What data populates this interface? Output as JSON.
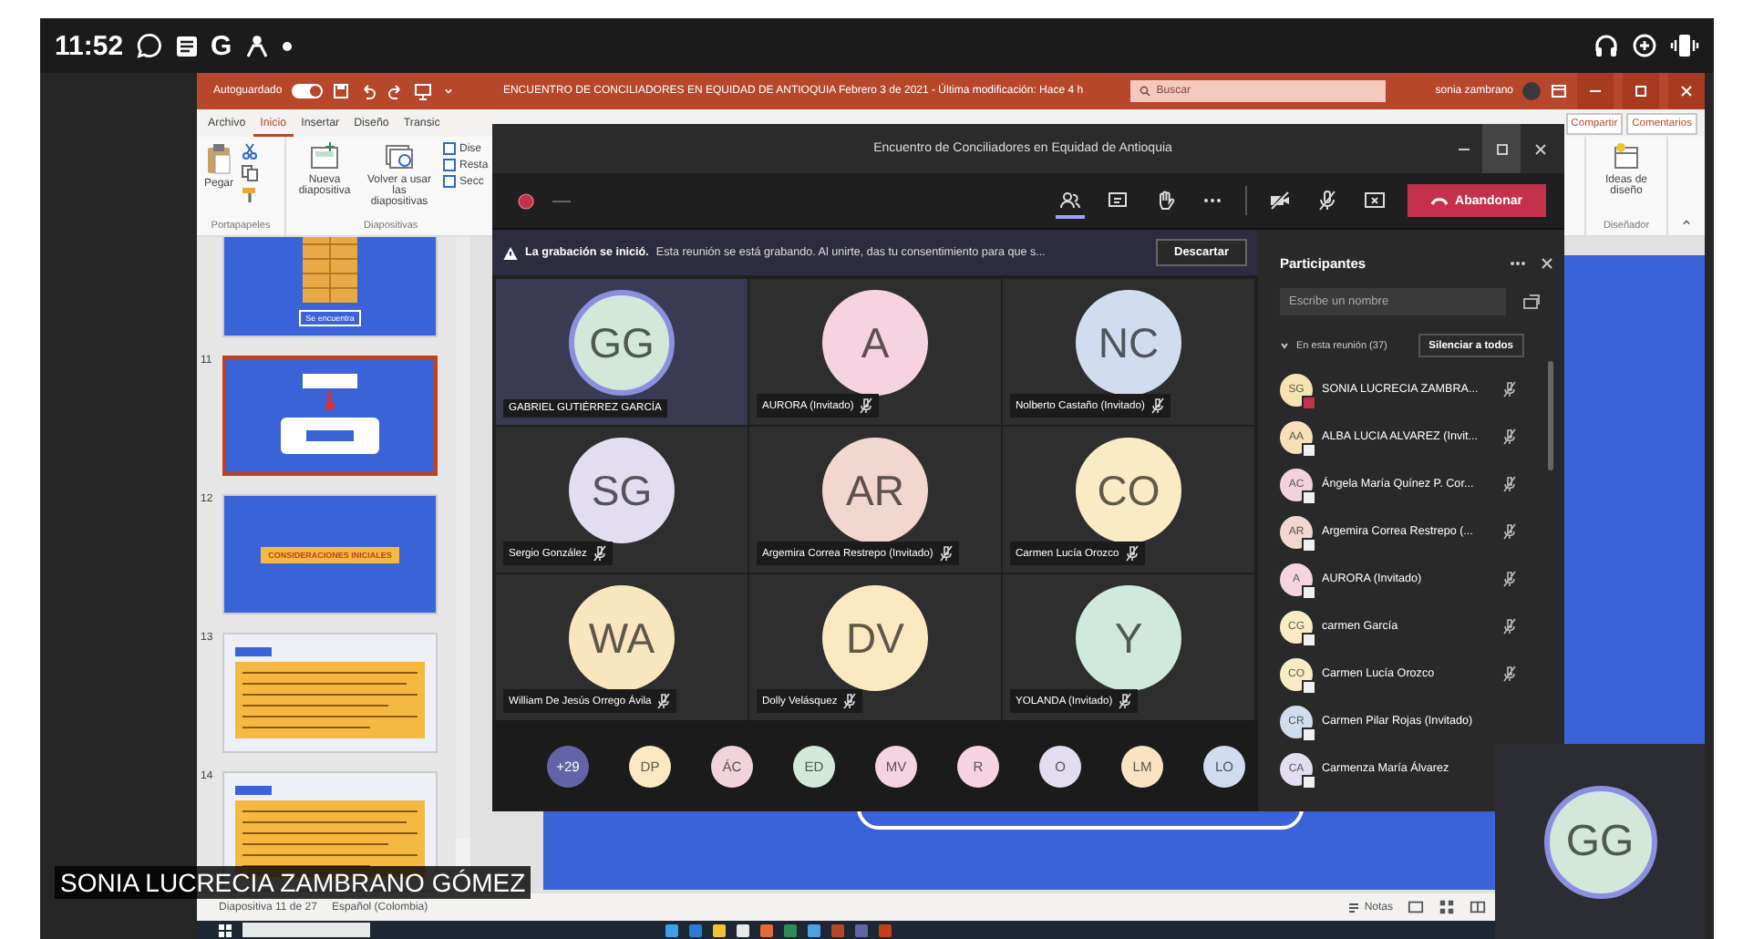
{
  "status_bar": {
    "time": "11:52",
    "app_letter": "G"
  },
  "powerpoint": {
    "autosave_label": "Autoguardado",
    "autosave_on": true,
    "title": "ENCUENTRO DE CONCILIADORES EN EQUIDAD DE ANTIOQUIA Febrero 3 de 2021 - Última modificación: Hace 4 h",
    "search_placeholder": "Buscar",
    "user": "sonia zambrano",
    "tabs": [
      {
        "label": "Archivo",
        "selected": false
      },
      {
        "label": "Inicio",
        "selected": true
      },
      {
        "label": "Insertar",
        "selected": false
      },
      {
        "label": "Diseño",
        "selected": false
      },
      {
        "label": "Transic",
        "selected": false
      }
    ],
    "share": "Compartir",
    "comments": "Comentarios",
    "ribbon": {
      "paste": "Pegar",
      "new_slide": "Nueva diapositiva",
      "reuse": "Volver a usar las diapositivas",
      "small_buttons": [
        "Dise",
        "Resta",
        "Secc"
      ],
      "groups": [
        "Portapapeles",
        "Diapositivas"
      ],
      "design_ideas": "Ideas de diseño",
      "designer_group": "Diseñador"
    },
    "thumbnails": [
      {
        "kind": "table",
        "label": "Se encuentra",
        "selected": false
      },
      {
        "kind": "diagram",
        "number": "11",
        "selected": true
      },
      {
        "kind": "banner",
        "number": "12",
        "label": "CONSIDERACIONES INICIALES",
        "selected": false
      },
      {
        "kind": "text",
        "number": "13",
        "selected": false
      },
      {
        "kind": "text",
        "number": "14",
        "selected": false
      }
    ],
    "status": {
      "slide_count": "Diapositiva 11 de 27",
      "language": "Español (Colombia)",
      "notes": "Notas"
    }
  },
  "teams": {
    "title": "Encuentro de Conciliadores en Equidad de Antioquia",
    "leave": "Abandonar",
    "banner": {
      "title": "La grabación se inició.",
      "text": "Esta reunión se está grabando. Al unirte, das tu consentimiento para que s...",
      "dismiss": "Descartar"
    },
    "tiles": [
      {
        "initials": "GG",
        "name": "GABRIEL GUTIÉRREZ GARCÍA",
        "color": "#d3e8d9",
        "speaking": true,
        "muted": false
      },
      {
        "initials": "A",
        "name": "AURORA (Invitado)",
        "color": "#f6d3e0",
        "speaking": false,
        "muted": true
      },
      {
        "initials": "NC",
        "name": "Nolberto Castaño (Invitado)",
        "color": "#d2dcef",
        "speaking": false,
        "muted": true
      },
      {
        "initials": "SG",
        "name": "Sergio González",
        "color": "#e3ddf0",
        "speaking": false,
        "muted": true
      },
      {
        "initials": "AR",
        "name": "Argemira Correa Restrepo (Invitado)",
        "color": "#f2d6d0",
        "speaking": false,
        "muted": true
      },
      {
        "initials": "CO",
        "name": "Carmen Lucía Orozco",
        "color": "#f9ecc4",
        "speaking": false,
        "muted": true
      },
      {
        "initials": "WA",
        "name": "William De Jesús Orrego Ávila",
        "color": "#f9e6bf",
        "speaking": false,
        "muted": true
      },
      {
        "initials": "DV",
        "name": "Dolly Velásquez",
        "color": "#f9e8c0",
        "speaking": false,
        "muted": true
      },
      {
        "initials": "Y",
        "name": "YOLANDA (Invitado)",
        "color": "#cfe9dc",
        "speaking": false,
        "muted": true
      }
    ],
    "overflow_count": "+29",
    "more": [
      {
        "initials": "DP",
        "color": "#f9e8c0"
      },
      {
        "initials": "ÁC",
        "color": "#f2d3dc"
      },
      {
        "initials": "ED",
        "color": "#d3e8d9"
      },
      {
        "initials": "MV",
        "color": "#f6d3e0"
      },
      {
        "initials": "R",
        "color": "#f6d3e0"
      },
      {
        "initials": "O",
        "color": "#e3ddf0"
      },
      {
        "initials": "LM",
        "color": "#f9e3c0"
      },
      {
        "initials": "LO",
        "color": "#d2dcef"
      }
    ],
    "participants": {
      "title": "Participantes",
      "search_placeholder": "Escribe un nombre",
      "section": "En esta reunión (37)",
      "mute_all": "Silenciar a todos",
      "people": [
        {
          "avatar": {
            "initials": "SG",
            "color": "#f5e3b3"
          },
          "badge": {
            "color": "#c4314b"
          },
          "name": "SONIA LUCRECIA ZAMBRA...",
          "muted": true
        },
        {
          "avatar": {
            "initials": "AA",
            "color": "#f7dfb9"
          },
          "badge": {
            "color": "#f0f0f0"
          },
          "name": "ALBA LUCIA ALVAREZ (Invit...",
          "muted": true
        },
        {
          "avatar": {
            "initials": "AC",
            "color": "#f2d3dc"
          },
          "badge": {
            "color": "#f0f0f0"
          },
          "name": "Ángela María Quínez P. Cor...",
          "muted": true
        },
        {
          "avatar": {
            "initials": "AR",
            "color": "#f2d6d0"
          },
          "badge": {
            "color": "#f0f0f0"
          },
          "name": "Argemira Correa Restrepo (...",
          "muted": true
        },
        {
          "avatar": {
            "initials": "A",
            "color": "#f6d3e0"
          },
          "badge": {
            "color": "#f0f0f0"
          },
          "name": "AURORA (Invitado)",
          "muted": true
        },
        {
          "avatar": {
            "initials": "CG",
            "color": "#f9ecc4"
          },
          "badge": {
            "color": "#f0f0f0"
          },
          "name": "carmen García",
          "muted": true
        },
        {
          "avatar": {
            "initials": "CO",
            "color": "#f9ecc4"
          },
          "badge": {
            "color": "#f0f0f0"
          },
          "name": "Carmen Lucía Orozco",
          "muted": true
        },
        {
          "avatar": {
            "initials": "CR",
            "color": "#d2dcef"
          },
          "badge": {
            "color": "#f0f0f0"
          },
          "name": "Carmen Pilar Rojas (Invitado)",
          "muted": false
        },
        {
          "avatar": {
            "initials": "CA",
            "color": "#e3ddf0"
          },
          "badge": {
            "color": "#f0f0f0"
          },
          "name": "Carmenza María Álvarez",
          "muted": false
        }
      ]
    }
  },
  "self_view": {
    "initials": "GG",
    "color": "#d3e8d9"
  },
  "caption": "SONIA LUCRECIA ZAMBRANO GÓMEZ"
}
